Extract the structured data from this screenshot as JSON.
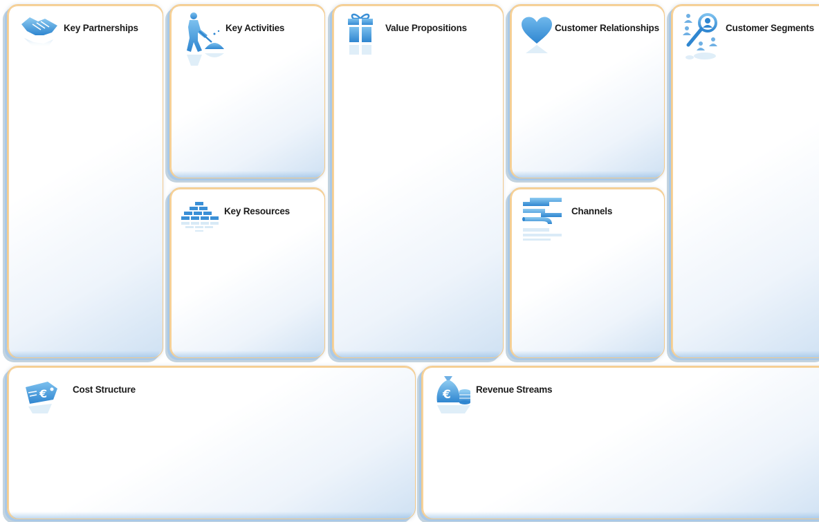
{
  "canvas": {
    "blocks": [
      {
        "id": "key_partnerships",
        "title": "Key Partnerships",
        "icon": "handshake-icon"
      },
      {
        "id": "key_activities",
        "title": "Key Activities",
        "icon": "worker-shovel-icon"
      },
      {
        "id": "key_resources",
        "title": "Key Resources",
        "icon": "bricks-icon"
      },
      {
        "id": "value_propositions",
        "title": "Value Propositions",
        "icon": "gift-icon"
      },
      {
        "id": "customer_relationships",
        "title": "Customer Relationships",
        "icon": "heart-icon"
      },
      {
        "id": "channels",
        "title": "Channels",
        "icon": "pipes-icon"
      },
      {
        "id": "customer_segments",
        "title": "Customer Segments",
        "icon": "people-magnifier-icon"
      },
      {
        "id": "cost_structure",
        "title": "Cost Structure",
        "icon": "euro-price-tag-icon"
      },
      {
        "id": "revenue_streams",
        "title": "Revenue Streams",
        "icon": "euro-money-bag-icon"
      }
    ]
  },
  "colors": {
    "icon_blue": "#3a8fd6",
    "icon_blue_light": "#7fbde9",
    "border_orange": "#f3c98a",
    "shadow_blue": "#a9c9e8",
    "title_text": "#1b1b1b"
  }
}
